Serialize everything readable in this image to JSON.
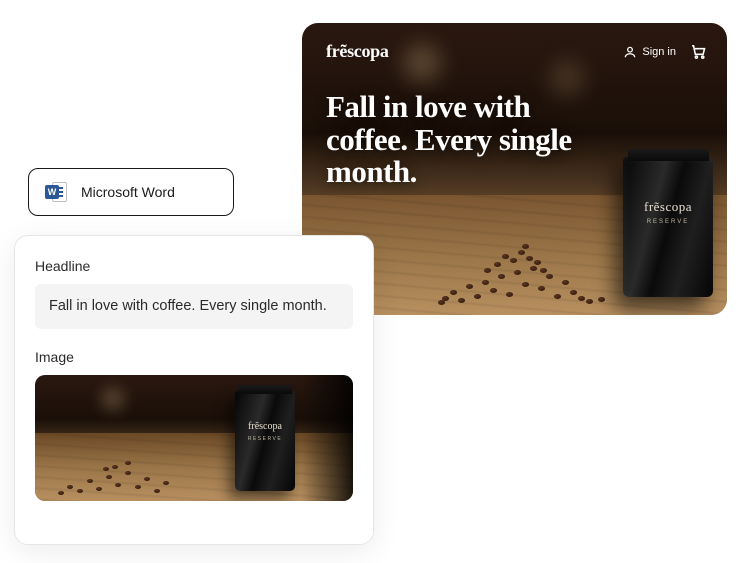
{
  "hero": {
    "brand": "frẽscopa",
    "signin_label": "Sign in",
    "headline": "Fall in love with coffee. Every single month.",
    "bag_brand": "frẽscopa",
    "bag_reserve": "Reserve"
  },
  "word_badge": {
    "label": "Microsoft Word",
    "glyph": "W"
  },
  "editor": {
    "headline_label": "Headline",
    "headline_value": "Fall in love with coffee. Every single month.",
    "image_label": "Image",
    "thumb_bag_brand": "frẽscopa",
    "thumb_bag_reserve": "Reserve"
  }
}
